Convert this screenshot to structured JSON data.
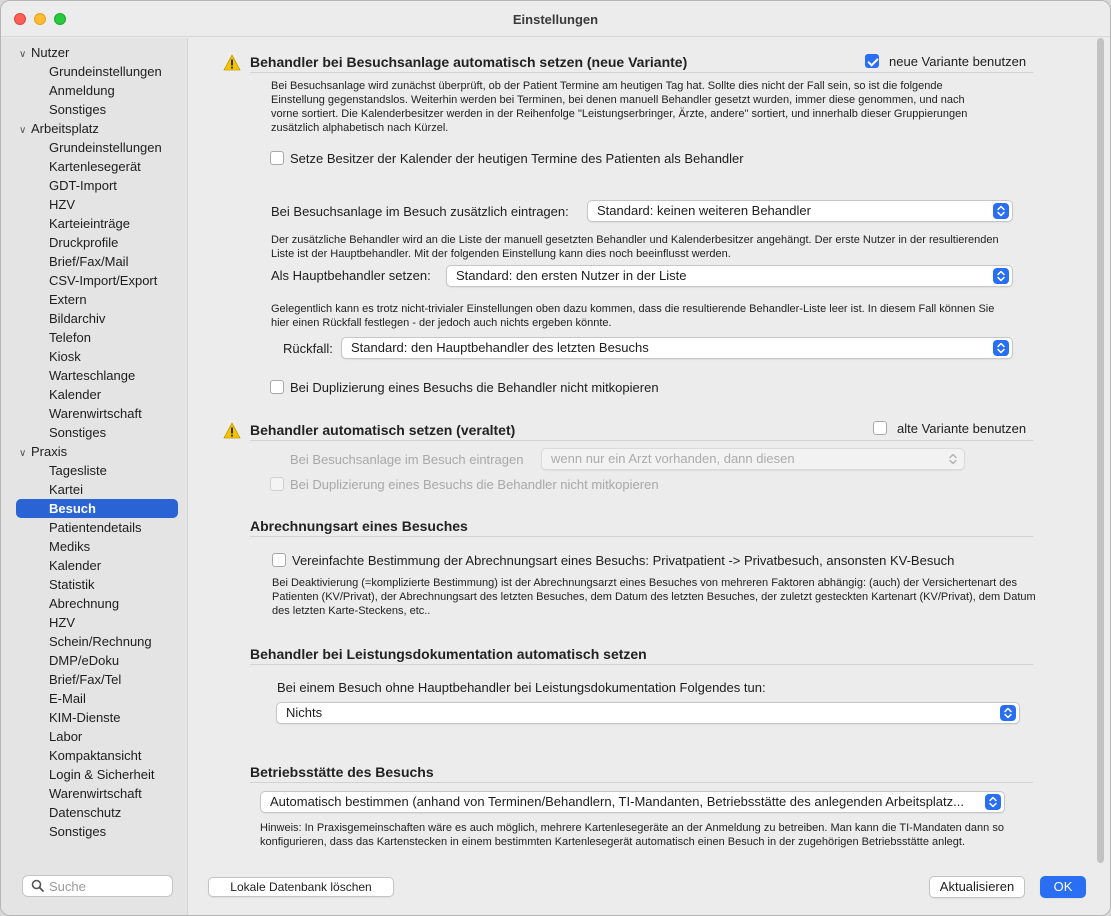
{
  "window": {
    "title": "Einstellungen"
  },
  "sidebar": {
    "groups": [
      {
        "label": "Nutzer",
        "items": [
          "Grundeinstellungen",
          "Anmeldung",
          "Sonstiges"
        ]
      },
      {
        "label": "Arbeitsplatz",
        "items": [
          "Grundeinstellungen",
          "Kartenlesegerät",
          "GDT-Import",
          "HZV",
          "Karteieinträge",
          "Druckprofile",
          "Brief/Fax/Mail",
          "CSV-Import/Export",
          "Extern",
          "Bildarchiv",
          "Telefon",
          "Kiosk",
          "Warteschlange",
          "Kalender",
          "Warenwirtschaft",
          "Sonstiges"
        ]
      },
      {
        "label": "Praxis",
        "items": [
          "Tagesliste",
          "Kartei",
          "Besuch",
          "Patientendetails",
          "Mediks",
          "Kalender",
          "Statistik",
          "Abrechnung",
          "HZV",
          "Schein/Rechnung",
          "DMP/eDoku",
          "Brief/Fax/Tel",
          "E-Mail",
          "KIM-Dienste",
          "Labor",
          "Kompaktansicht",
          "Login & Sicherheit",
          "Warenwirtschaft",
          "Datenschutz",
          "Sonstiges"
        ]
      }
    ],
    "selected": "Besuch",
    "search_placeholder": "Suche"
  },
  "s1": {
    "title": "Behandler bei Besuchsanlage automatisch setzen (neue Variante)",
    "toggle_label": "neue Variante benutzen",
    "toggle_checked": true,
    "desc": "Bei Besuchsanlage wird zunächst überprüft, ob der Patient Termine am heutigen Tag hat. Sollte dies nicht der Fall sein, so ist die folgende Einstellung gegenstandslos. Weiterhin werden bei Terminen, bei denen manuell Behandler gesetzt wurden, immer diese genommen, und nach vorne sortiert. Die Kalenderbesitzer werden in der Reihenfolge \"Leistungserbringer, Ärzte, andere\" sortiert, und innerhalb dieser Gruppierungen zusätzlich alphabetisch nach Kürzel.",
    "cb_owner": "Setze Besitzer der Kalender der heutigen Termine des Patienten als Behandler",
    "extra_label": "Bei Besuchsanlage im Besuch zusätzlich eintragen:",
    "extra_value": "Standard: keinen weiteren Behandler",
    "extra_desc": "Der zusätzliche Behandler wird an die Liste der manuell gesetzten Behandler und Kalenderbesitzer angehängt. Der erste Nutzer in der resultierenden Liste ist der Hauptbehandler. Mit der folgenden Einstellung kann dies noch beeinflusst werden.",
    "main_label": "Als Hauptbehandler setzen:",
    "main_value": "Standard: den ersten Nutzer in der Liste",
    "fallback_desc": "Gelegentlich kann es trotz nicht-trivialer Einstellungen oben dazu kommen, dass die resultierende Behandler-Liste leer ist. In diesem Fall können Sie hier einen Rückfall festlegen - der jedoch auch nichts ergeben könnte.",
    "fallback_label": "Rückfall:",
    "fallback_value": "Standard: den Hauptbehandler des letzten Besuchs",
    "cb_dup": "Bei Duplizierung eines Besuchs die Behandler nicht mitkopieren"
  },
  "s2": {
    "title": "Behandler automatisch setzen (veraltet)",
    "toggle_label": "alte Variante benutzen",
    "toggle_checked": false,
    "entry_label": "Bei Besuchsanlage im Besuch eintragen",
    "entry_value": "wenn nur ein Arzt vorhanden, dann diesen",
    "cb_dup": "Bei Duplizierung eines Besuchs die Behandler nicht mitkopieren"
  },
  "s3": {
    "title": "Abrechnungsart eines Besuches",
    "cb": "Vereinfachte Bestimmung der Abrechnungsart eines Besuchs: Privatpatient -> Privatbesuch, ansonsten KV-Besuch",
    "desc": "Bei Deaktivierung (=komplizierte Bestimmung) ist der Abrechnungsarzt eines Besuches von mehreren Faktoren abhängig: (auch) der Versichertenart des Patienten (KV/Privat), der Abrechnungsart des letzten Besuches, dem Datum des letzten Besuches, der zuletzt gesteckten Kartenart (KV/Privat), dem Datum des letzten Karte-Steckens, etc.."
  },
  "s4": {
    "title": "Behandler bei Leistungsdokumentation automatisch setzen",
    "label": "Bei einem Besuch ohne Hauptbehandler bei Leistungsdokumentation Folgendes tun:",
    "value": "Nichts"
  },
  "s5": {
    "title": "Betriebsstätte des Besuchs",
    "value": "Automatisch bestimmen (anhand von Terminen/Behandlern, TI-Mandanten, Betriebsstätte des anlegenden Arbeitsplatz...",
    "desc": "Hinweis: In Praxisgemeinschaften wäre es auch möglich, mehrere Kartenlesegeräte an der Anmeldung zu betreiben. Man kann die TI-Mandaten dann so konfigurieren, dass das Kartenstecken in einem bestimmten Kartenlesegerät automatisch einen Besuch in der zugehörigen Betriebsstätte anlegt."
  },
  "footer": {
    "delete_db": "Lokale Datenbank löschen",
    "refresh": "Aktualisieren",
    "ok": "OK"
  },
  "colors": {
    "accent": "#2a6ff3",
    "selection": "#2a63d4",
    "warning": "#f5c400"
  }
}
